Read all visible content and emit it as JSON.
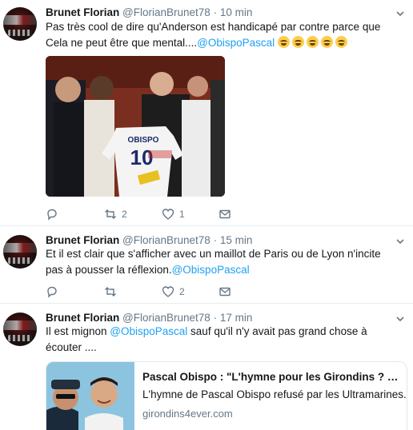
{
  "colors": {
    "link": "#1da1f2",
    "muted": "#657786",
    "text": "#14171a",
    "divider": "#e6ecf0",
    "like": "#e0245e"
  },
  "icons": [
    "reply-icon",
    "retweet-icon",
    "like-icon",
    "direct-message-icon",
    "chevron-down-icon"
  ],
  "tweets": [
    {
      "name": "Brunet Florian",
      "handle": "@FlorianBrunet78",
      "sep": "·",
      "time": "10 min",
      "text_part1": "Pas très cool de dire qu'Anderson est handicapé par contre parce que Cela ne peut être que mental....",
      "mention": "@ObispoPascal",
      "emoji_count": 5,
      "retweets": "2",
      "likes": "1",
      "photo": {
        "jersey_name": "OBISPO",
        "jersey_number": "10"
      }
    },
    {
      "name": "Brunet Florian",
      "handle": "@FlorianBrunet78",
      "sep": "·",
      "time": "15 min",
      "text_part1": "Et il est clair que s'afficher avec un maillot de Paris ou de Lyon n'incite pas à pousser la réflexion.",
      "mention": "@ObispoPascal",
      "retweets": "",
      "likes": "2"
    },
    {
      "name": "Brunet Florian",
      "handle": "@FlorianBrunet78",
      "sep": "·",
      "time": "17 min",
      "text_part1": "Il est mignon ",
      "mention": "@ObispoPascal",
      "text_part2": " sauf qu'il n'y avait pas grand chose à écouter ....",
      "card": {
        "title": "Pascal Obispo : \"L'hymne pour les Girondins ? Il…",
        "description": "L'hymne de Pascal Obispo refusé par les Ultramarines.",
        "domain": "girondins4ever.com"
      }
    }
  ]
}
